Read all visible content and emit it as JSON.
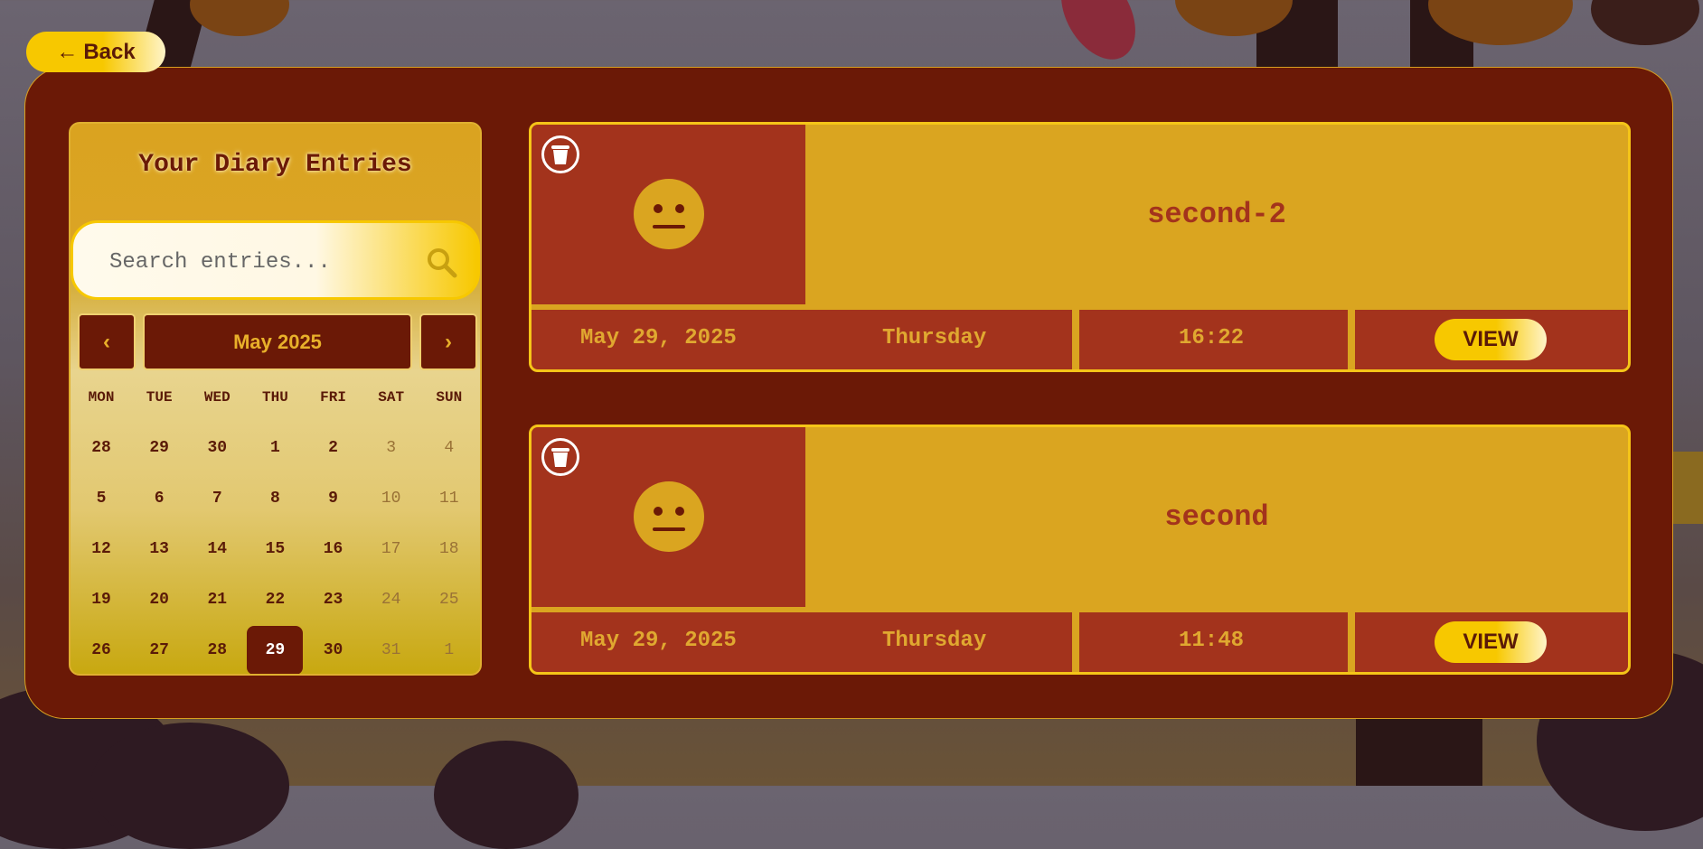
{
  "back_button": {
    "arrow": "←",
    "label": "Back"
  },
  "sidebar": {
    "title": "Your Diary Entries",
    "search": {
      "placeholder": "Search entries...",
      "value": ""
    },
    "calendar": {
      "prev": "‹",
      "next": "›",
      "month_label": "May 2025",
      "weekdays": [
        "MON",
        "TUE",
        "WED",
        "THU",
        "FRI",
        "SAT",
        "SUN"
      ],
      "days": [
        [
          "28",
          "29",
          "30",
          "1",
          "2",
          "3",
          "4"
        ],
        [
          "5",
          "6",
          "7",
          "8",
          "9",
          "10",
          "11"
        ],
        [
          "12",
          "13",
          "14",
          "15",
          "16",
          "17",
          "18"
        ],
        [
          "19",
          "20",
          "21",
          "22",
          "23",
          "24",
          "25"
        ],
        [
          "26",
          "27",
          "28",
          "29",
          "30",
          "31",
          "1"
        ]
      ],
      "selected_day": "29"
    }
  },
  "entries": [
    {
      "title": "second-2",
      "date": "May 29, 2025",
      "weekday": "Thursday",
      "time": "16:22",
      "view_label": "VIEW",
      "mood_icon": "neutral-face-icon"
    },
    {
      "title": "second",
      "date": "May 29, 2025",
      "weekday": "Thursday",
      "time": "11:48",
      "view_label": "VIEW",
      "mood_icon": "neutral-face-icon"
    }
  ],
  "colors": {
    "panel": "#6b1906",
    "card": "#daa520",
    "accent": "#f7c800",
    "footer": "#a3331c"
  }
}
